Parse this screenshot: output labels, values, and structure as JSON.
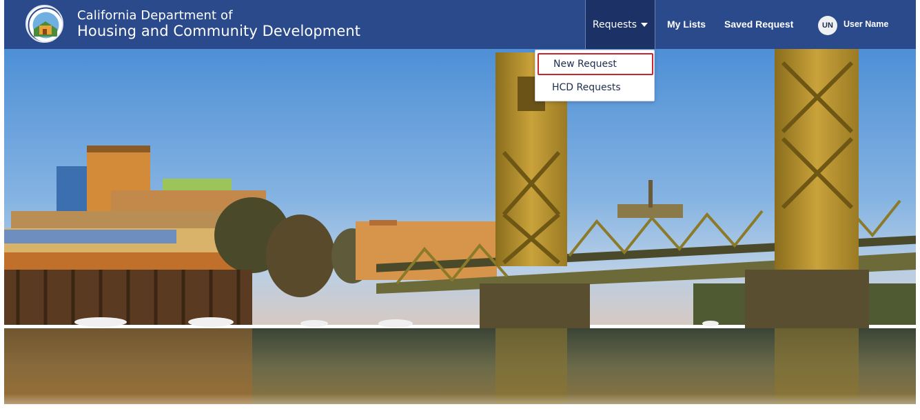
{
  "header": {
    "brand_line1": "California Department of",
    "brand_line2": "Housing and Community Development",
    "bg_color": "#2a4a8c",
    "logo_icon": "california-seal-icon"
  },
  "nav": {
    "requests_label": "Requests",
    "my_lists_label": "My Lists",
    "saved_request_label": "Saved Request",
    "user_initials": "UN",
    "user_name": "User Name"
  },
  "dropdown": {
    "items": [
      {
        "label": "New Request",
        "highlighted": true
      },
      {
        "label": "HCD Requests",
        "highlighted": false
      }
    ],
    "highlight_color": "#c8262e"
  },
  "hero": {
    "image": "Tower Bridge and river waterfront at sunset"
  }
}
